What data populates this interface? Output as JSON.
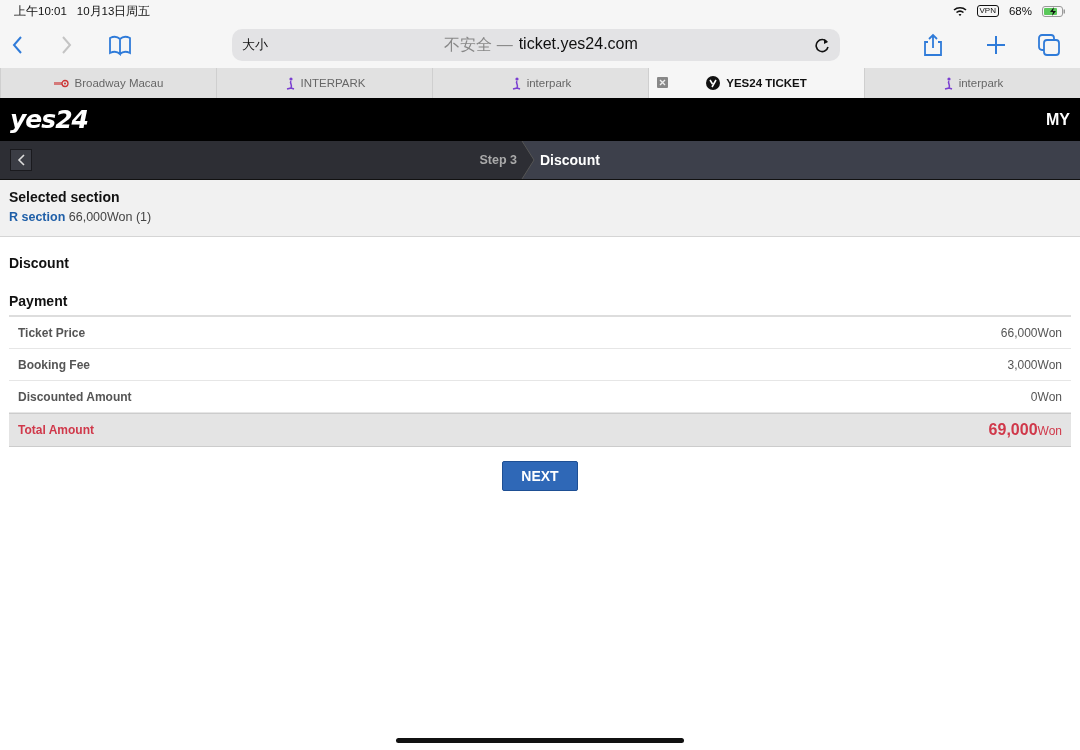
{
  "status_bar": {
    "time": "上午10:01",
    "date": "10月13日周五",
    "vpn": "VPN",
    "battery": "68%"
  },
  "toolbar": {
    "text_size": "大小",
    "address_prefix": "不安全 —",
    "address": "ticket.yes24.com"
  },
  "tabs": [
    {
      "label": "Broadway Macau",
      "kind": "macau",
      "selected": false
    },
    {
      "label": "INTERPARK",
      "kind": "interpark",
      "selected": false
    },
    {
      "label": "interpark",
      "kind": "interpark",
      "selected": false
    },
    {
      "label": "YES24 TICKET",
      "kind": "yes24",
      "selected": true
    },
    {
      "label": "interpark",
      "kind": "interpark",
      "selected": false
    }
  ],
  "header": {
    "logo": "yes24",
    "menu": "MY"
  },
  "step_bar": {
    "step": "Step 3",
    "title": "Discount"
  },
  "selected_section": {
    "heading": "Selected section",
    "section": "R section",
    "price": "66,000Won (1)"
  },
  "discount": {
    "heading": "Discount"
  },
  "payment": {
    "heading": "Payment",
    "rows": [
      {
        "label": "Ticket Price",
        "value": "66,000Won",
        "kind": "line"
      },
      {
        "label": "Booking Fee",
        "value": "3,000Won",
        "kind": "line"
      },
      {
        "label": "Discounted Amount",
        "value": "0Won",
        "kind": "line"
      },
      {
        "label": "Total Amount",
        "value": "69,000",
        "unit": "Won",
        "kind": "total"
      }
    ]
  },
  "next_button": "NEXT"
}
